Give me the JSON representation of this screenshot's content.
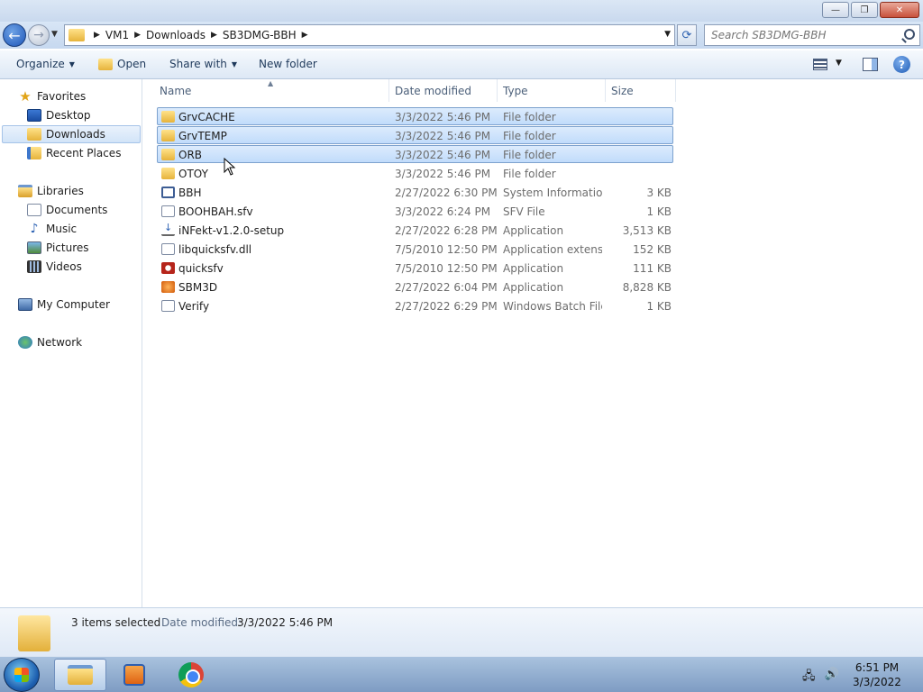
{
  "window": {
    "buttons": {
      "minimize": "—",
      "maximize": "❐",
      "close": "✕"
    }
  },
  "address": {
    "crumbs": [
      "VM1",
      "Downloads",
      "SB3DMG-BBH"
    ],
    "search_placeholder": "Search SB3DMG-BBH"
  },
  "toolbar": {
    "organize": "Organize",
    "open": "Open",
    "share_with": "Share with",
    "new_folder": "New folder"
  },
  "nav": {
    "favorites": "Favorites",
    "desktop": "Desktop",
    "downloads": "Downloads",
    "recent_places": "Recent Places",
    "libraries": "Libraries",
    "documents": "Documents",
    "music": "Music",
    "pictures": "Pictures",
    "videos": "Videos",
    "my_computer": "My Computer",
    "network": "Network",
    "selected": "Downloads"
  },
  "columns": {
    "name": "Name",
    "date_modified": "Date modified",
    "type": "Type",
    "size": "Size"
  },
  "files": [
    {
      "name": "GrvCACHE",
      "date": "3/3/2022 5:46 PM",
      "type": "File folder",
      "size": "",
      "icon": "folder-icon",
      "selected": true
    },
    {
      "name": "GrvTEMP",
      "date": "3/3/2022 5:46 PM",
      "type": "File folder",
      "size": "",
      "icon": "folder-icon",
      "selected": true
    },
    {
      "name": "ORB",
      "date": "3/3/2022 5:46 PM",
      "type": "File folder",
      "size": "",
      "icon": "folder-icon",
      "selected": true
    },
    {
      "name": "OTOY",
      "date": "3/3/2022 5:46 PM",
      "type": "File folder",
      "size": "",
      "icon": "folder-icon",
      "selected": false
    },
    {
      "name": "BBH",
      "date": "2/27/2022 6:30 PM",
      "type": "System Informatio...",
      "size": "3 KB",
      "icon": "system-info-icon",
      "selected": false
    },
    {
      "name": "BOOHBAH.sfv",
      "date": "3/3/2022 6:24 PM",
      "type": "SFV File",
      "size": "1 KB",
      "icon": "file-icon",
      "selected": false
    },
    {
      "name": "iNFekt-v1.2.0-setup",
      "date": "2/27/2022 6:28 PM",
      "type": "Application",
      "size": "3,513 KB",
      "icon": "installer-icon",
      "selected": false
    },
    {
      "name": "libquicksfv.dll",
      "date": "7/5/2010 12:50 PM",
      "type": "Application extens...",
      "size": "152 KB",
      "icon": "dll-icon",
      "selected": false
    },
    {
      "name": "quicksfv",
      "date": "7/5/2010 12:50 PM",
      "type": "Application",
      "size": "111 KB",
      "icon": "quicksfv-app-icon",
      "selected": false
    },
    {
      "name": "SBM3D",
      "date": "2/27/2022 6:04 PM",
      "type": "Application",
      "size": "8,828 KB",
      "icon": "sbm3d-app-icon",
      "selected": false
    },
    {
      "name": "Verify",
      "date": "2/27/2022 6:29 PM",
      "type": "Windows Batch File",
      "size": "1 KB",
      "icon": "batch-file-icon",
      "selected": false
    }
  ],
  "details": {
    "count": "3 items selected",
    "date_label": "Date modified:",
    "date_value": "3/3/2022 5:46 PM"
  },
  "taskbar": {
    "time": "6:51 PM",
    "date": "3/3/2022"
  }
}
